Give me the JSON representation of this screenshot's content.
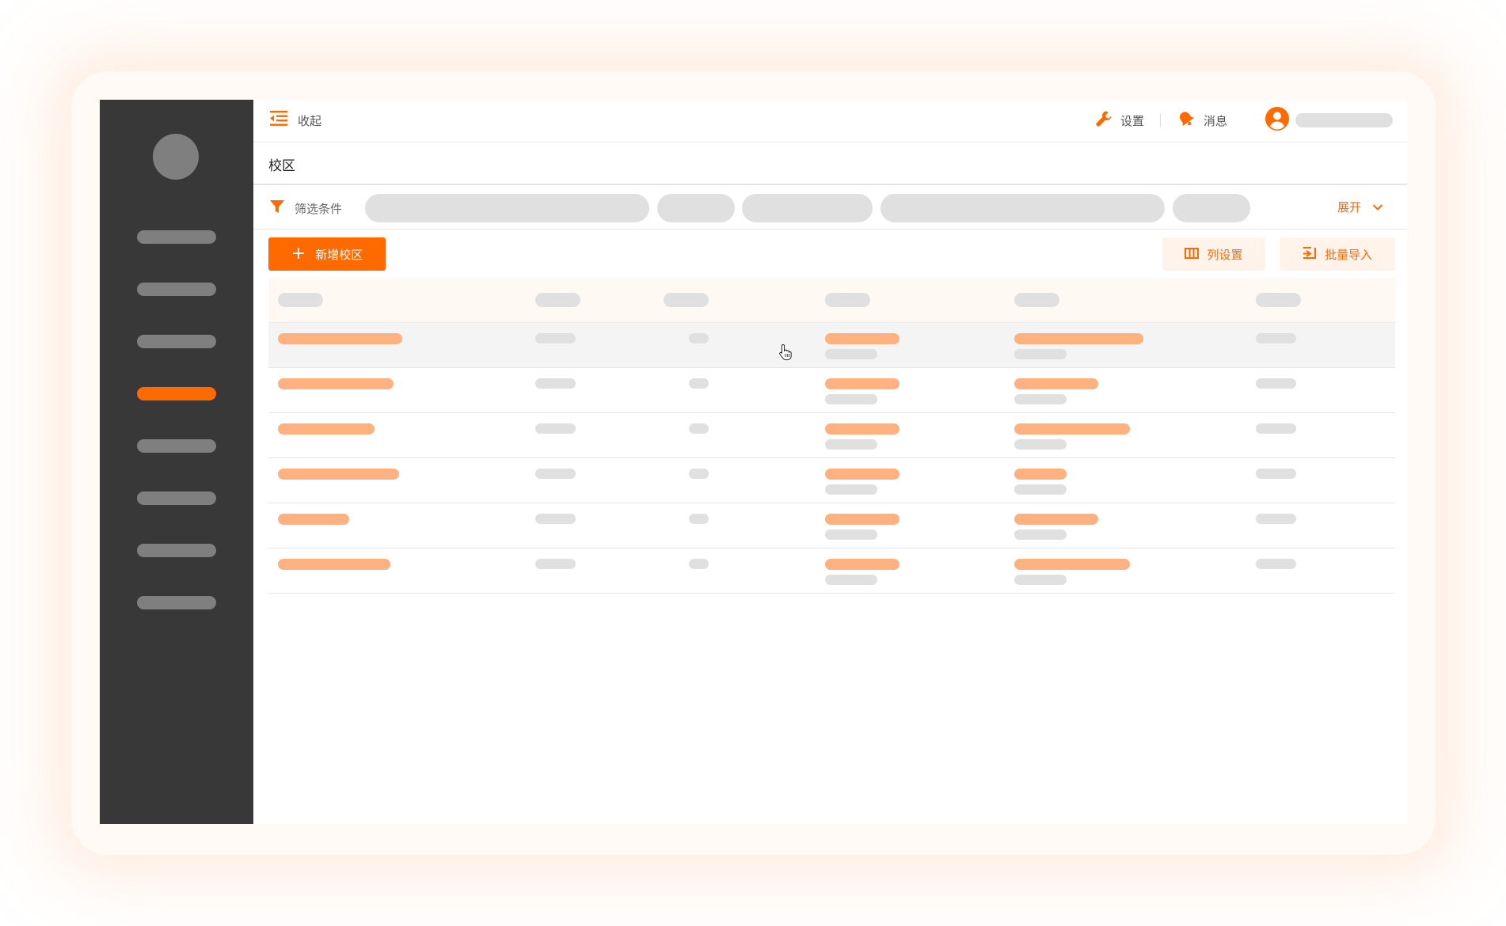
{
  "app": {
    "accent": "#ff6a00",
    "sidebar_bg": "#383838",
    "skeleton_gray": "#e0e0e0",
    "skeleton_orange": "#ffb27f"
  },
  "sidebar": {
    "item_count": 8,
    "active_index": 3
  },
  "topbar": {
    "collapse_label": "收起",
    "settings_label": "设置",
    "messages_label": "消息",
    "icons": {
      "collapse": "menu-collapse-icon",
      "settings": "wrench-icon",
      "messages": "bell-icon",
      "user": "user-avatar-icon"
    }
  },
  "page": {
    "title": "校区"
  },
  "filter": {
    "label": "筛选条件",
    "expand_label": "展开",
    "icons": {
      "filter": "filter-icon",
      "expand": "chevron-down-icon"
    }
  },
  "toolbar": {
    "add_label": "新增校区",
    "column_settings_label": "列设置",
    "bulk_import_label": "批量导入",
    "icons": {
      "add": "plus-icon",
      "columns": "columns-icon",
      "import": "import-icon"
    }
  },
  "table": {
    "row_count": 6,
    "hovered_row": 0
  }
}
